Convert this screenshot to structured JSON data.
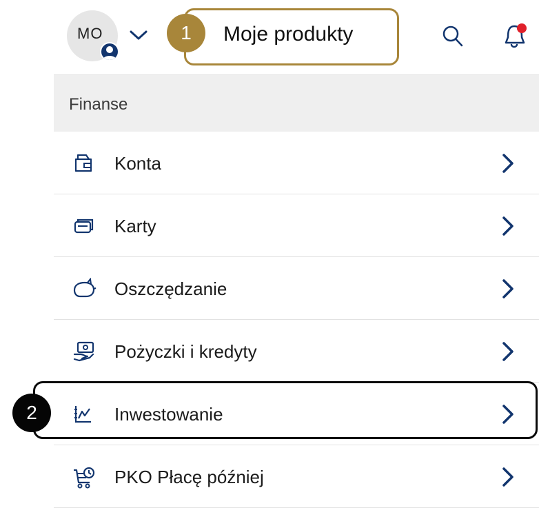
{
  "header": {
    "avatar_initials": "MO",
    "title": "Moje produkty",
    "search_icon": "search-icon",
    "notification_icon": "bell-icon",
    "notification_dot_color": "#e0202a"
  },
  "annotations": {
    "marker1": "1",
    "marker2": "2",
    "accent_color": "#a8863a"
  },
  "section": {
    "label": "Finanse"
  },
  "items": [
    {
      "label": "Konta",
      "icon": "wallet-icon"
    },
    {
      "label": "Karty",
      "icon": "cards-icon"
    },
    {
      "label": "Oszczędzanie",
      "icon": "piggy-bank-icon"
    },
    {
      "label": "Pożyczki i kredyty",
      "icon": "loan-icon"
    },
    {
      "label": "Inwestowanie",
      "icon": "chart-icon"
    },
    {
      "label": "PKO Płacę później",
      "icon": "cart-clock-icon"
    }
  ],
  "colors": {
    "icon_navy": "#12356e",
    "section_bg": "#efefef"
  }
}
